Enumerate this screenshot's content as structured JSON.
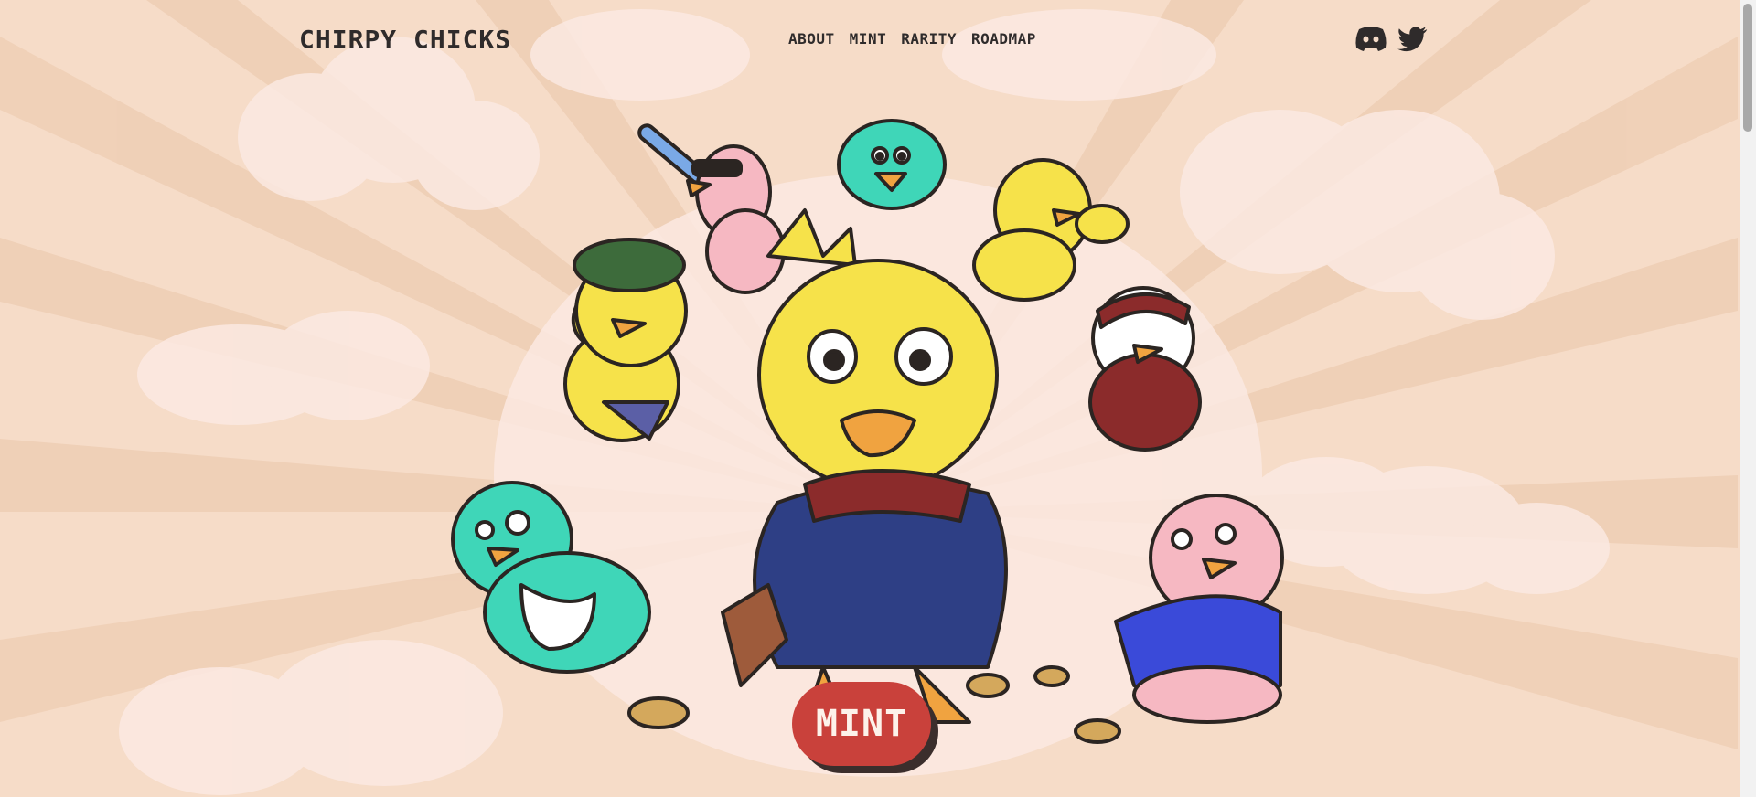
{
  "site": {
    "logo": "Chirpy Chicks"
  },
  "nav": {
    "items": [
      "About",
      "Mint",
      "Rarity",
      "Roadmap"
    ]
  },
  "social": {
    "icons": [
      "discord-icon",
      "twitter-icon"
    ]
  },
  "hero": {
    "mint_label": "Mint"
  },
  "colors": {
    "background": "#f6dcc8",
    "ray": "#efcfb6",
    "cloud": "#fbe9e2",
    "text": "#2f2b2b",
    "button": "#c9413b",
    "yellow_chick": "#f6e24a",
    "teal_chick": "#3fd6b8",
    "pink_chick": "#f6b8c2"
  }
}
